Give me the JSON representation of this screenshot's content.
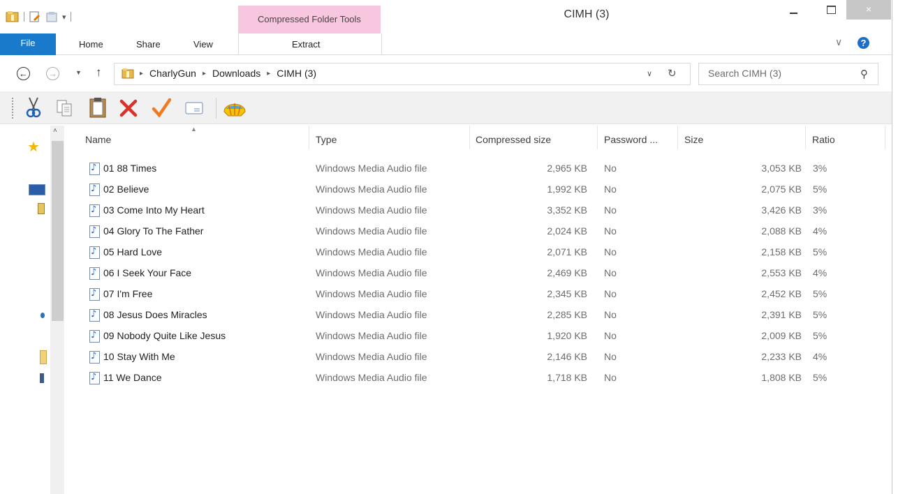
{
  "window": {
    "title": "CIMH (3)",
    "context_tab_group": "Compressed Folder Tools",
    "close_glyph": "×",
    "min_glyph": "–",
    "max_glyph": "□"
  },
  "ribbon": {
    "tabs": [
      "File",
      "Home",
      "Share",
      "View"
    ],
    "context_tab": "Extract",
    "expand_glyph": "∨",
    "help_glyph": "?"
  },
  "address": {
    "breadcrumb": [
      "CharlyGun",
      "Downloads",
      "CIMH (3)"
    ],
    "separator": "▸",
    "search_placeholder": "Search CIMH (3)"
  },
  "toolbar": {
    "icons": [
      "cut-icon",
      "copy-icon",
      "paste-icon",
      "delete-icon",
      "check-icon",
      "rename-icon",
      "shell-icon"
    ]
  },
  "columns": {
    "name": "Name",
    "type": "Type",
    "compressed_size": "Compressed size",
    "password": "Password ...",
    "size": "Size",
    "ratio": "Ratio"
  },
  "files": [
    {
      "name": "01 88 Times",
      "type": "Windows Media Audio file",
      "compressed": "2,965 KB",
      "password": "No",
      "size": "3,053 KB",
      "ratio": "3%"
    },
    {
      "name": "02 Believe",
      "type": "Windows Media Audio file",
      "compressed": "1,992 KB",
      "password": "No",
      "size": "2,075 KB",
      "ratio": "5%"
    },
    {
      "name": "03 Come Into My Heart",
      "type": "Windows Media Audio file",
      "compressed": "3,352 KB",
      "password": "No",
      "size": "3,426 KB",
      "ratio": "3%"
    },
    {
      "name": "04 Glory To The Father",
      "type": "Windows Media Audio file",
      "compressed": "2,024 KB",
      "password": "No",
      "size": "2,088 KB",
      "ratio": "4%"
    },
    {
      "name": "05 Hard Love",
      "type": "Windows Media Audio file",
      "compressed": "2,071 KB",
      "password": "No",
      "size": "2,158 KB",
      "ratio": "5%"
    },
    {
      "name": "06 I Seek Your Face",
      "type": "Windows Media Audio file",
      "compressed": "2,469 KB",
      "password": "No",
      "size": "2,553 KB",
      "ratio": "4%"
    },
    {
      "name": "07 I'm Free",
      "type": "Windows Media Audio file",
      "compressed": "2,345 KB",
      "password": "No",
      "size": "2,452 KB",
      "ratio": "5%"
    },
    {
      "name": "08 Jesus Does Miracles",
      "type": "Windows Media Audio file",
      "compressed": "2,285 KB",
      "password": "No",
      "size": "2,391 KB",
      "ratio": "5%"
    },
    {
      "name": "09 Nobody Quite Like Jesus",
      "type": "Windows Media Audio file",
      "compressed": "1,920 KB",
      "password": "No",
      "size": "2,009 KB",
      "ratio": "5%"
    },
    {
      "name": "10 Stay With Me",
      "type": "Windows Media Audio file",
      "compressed": "2,146 KB",
      "password": "No",
      "size": "2,233 KB",
      "ratio": "4%"
    },
    {
      "name": "11 We Dance",
      "type": "Windows Media Audio file",
      "compressed": "1,718 KB",
      "password": "No",
      "size": "1,808 KB",
      "ratio": "5%"
    }
  ],
  "colors": {
    "file_tab": "#1979ca",
    "context_tab": "#f7c6df",
    "help": "#1e6ec8"
  }
}
